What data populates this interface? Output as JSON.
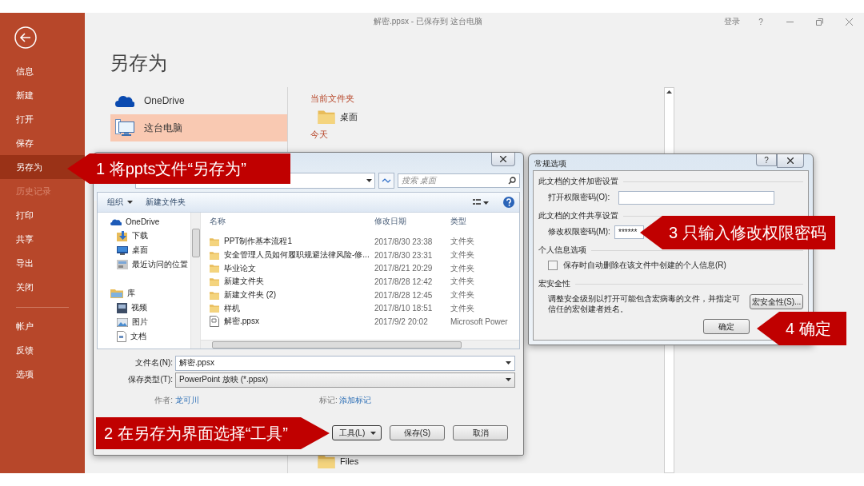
{
  "window": {
    "title": "解密.ppsx - 已保存到 这台电脑",
    "sign_in": "登录",
    "help": "?"
  },
  "backstage": {
    "items": [
      {
        "label": "信息",
        "selected": false,
        "disabled": false
      },
      {
        "label": "新建",
        "selected": false,
        "disabled": false
      },
      {
        "label": "打开",
        "selected": false,
        "disabled": false
      },
      {
        "label": "保存",
        "selected": false,
        "disabled": false
      },
      {
        "label": "另存为",
        "selected": true,
        "disabled": false
      },
      {
        "label": "历史记录",
        "selected": false,
        "disabled": true
      },
      {
        "label": "打印",
        "selected": false,
        "disabled": false
      },
      {
        "label": "共享",
        "selected": false,
        "disabled": false
      },
      {
        "label": "导出",
        "selected": false,
        "disabled": false
      },
      {
        "label": "关闭",
        "selected": false,
        "disabled": false
      }
    ],
    "bottom_items": [
      {
        "label": "帐户",
        "selected": false,
        "disabled": false
      },
      {
        "label": "反馈",
        "selected": false,
        "disabled": false
      },
      {
        "label": "选项",
        "selected": false,
        "disabled": false
      }
    ],
    "heading": "另存为",
    "places": [
      {
        "label": "OneDrive",
        "kind": "cloud",
        "selected": false
      },
      {
        "label": "这台电脑",
        "kind": "computer",
        "selected": true
      }
    ],
    "current_header": "当前文件夹",
    "current": [
      {
        "name": "桌面"
      }
    ],
    "today_header": "今天",
    "today": [
      {
        "name": "Files"
      }
    ]
  },
  "save_dialog": {
    "search_placeholder": "搜索 桌面",
    "organize": "组织",
    "new_folder": "新建文件夹",
    "nav_groups": [
      [
        {
          "label": "OneDrive",
          "kind": "cloud"
        },
        {
          "label": "下载",
          "kind": "download"
        },
        {
          "label": "桌面",
          "kind": "desktop"
        },
        {
          "label": "最近访问的位置",
          "kind": "recent"
        }
      ],
      [
        {
          "label": "库",
          "kind": "library"
        },
        {
          "label": "视频",
          "kind": "video"
        },
        {
          "label": "图片",
          "kind": "picture"
        },
        {
          "label": "文档",
          "kind": "document"
        }
      ]
    ],
    "columns": [
      "名称",
      "修改日期",
      "类型"
    ],
    "files": [
      {
        "name": "PPT制作基本流程1",
        "date": "2017/8/30 23:38",
        "type": "文件夹",
        "kind": "folder"
      },
      {
        "name": "安全管理人员如何履职规避法律风险-修...",
        "date": "2017/8/30 23:31",
        "type": "文件夹",
        "kind": "folder"
      },
      {
        "name": "毕业论文",
        "date": "2017/8/21 20:29",
        "type": "文件夹",
        "kind": "folder"
      },
      {
        "name": "新建文件夹",
        "date": "2017/8/28 12:42",
        "type": "文件夹",
        "kind": "folder"
      },
      {
        "name": "新建文件夹 (2)",
        "date": "2017/8/28 12:45",
        "type": "文件夹",
        "kind": "folder"
      },
      {
        "name": "样机",
        "date": "2017/8/10 18:51",
        "type": "文件夹",
        "kind": "folder"
      },
      {
        "name": "解密.ppsx",
        "date": "2017/9/2 20:02",
        "type": "Microsoft Power",
        "kind": "file"
      }
    ],
    "filename_label": "文件名(N):",
    "filename": "解密.ppsx",
    "type_label": "保存类型(T):",
    "type_value": "PowerPoint 放映 (*.ppsx)",
    "author_label": "作者:",
    "author": "龙可川",
    "tags_label": "标记:",
    "tags": "添加标记",
    "buttons": [
      {
        "label": "工具(L)",
        "kind": "menu"
      },
      {
        "label": "保存(S)",
        "kind": "plain"
      },
      {
        "label": "取消",
        "kind": "plain"
      }
    ]
  },
  "options_dialog": {
    "title": "常规选项",
    "help_button": "?",
    "encrypt_header": "此文档的文件加密设置",
    "open_password_label": "打开权限密码(O):",
    "share_header": "此文档的文件共享设置",
    "modify_password_label": "修改权限密码(M):",
    "modify_password": "******",
    "privacy_header": "个人信息选项",
    "remove_info": {
      "label": "保存时自动删除在该文件中创建的个人信息(R)",
      "checked": false
    },
    "macro_header": "宏安全性",
    "macro_text": "调整安全级别以打开可能包含宏病毒的文件，并指定可信任的宏创建者姓名。",
    "macro_button": "宏安全性(S)...",
    "ok": "确定"
  },
  "callouts": [
    {
      "text": "1 将ppts文件“另存为”",
      "kind": "left"
    },
    {
      "text": "2 在另存为界面选择“工具”",
      "kind": "right"
    },
    {
      "text": "3 只输入修改权限密码",
      "kind": "left"
    },
    {
      "text": "4 确定",
      "kind": "left"
    }
  ]
}
